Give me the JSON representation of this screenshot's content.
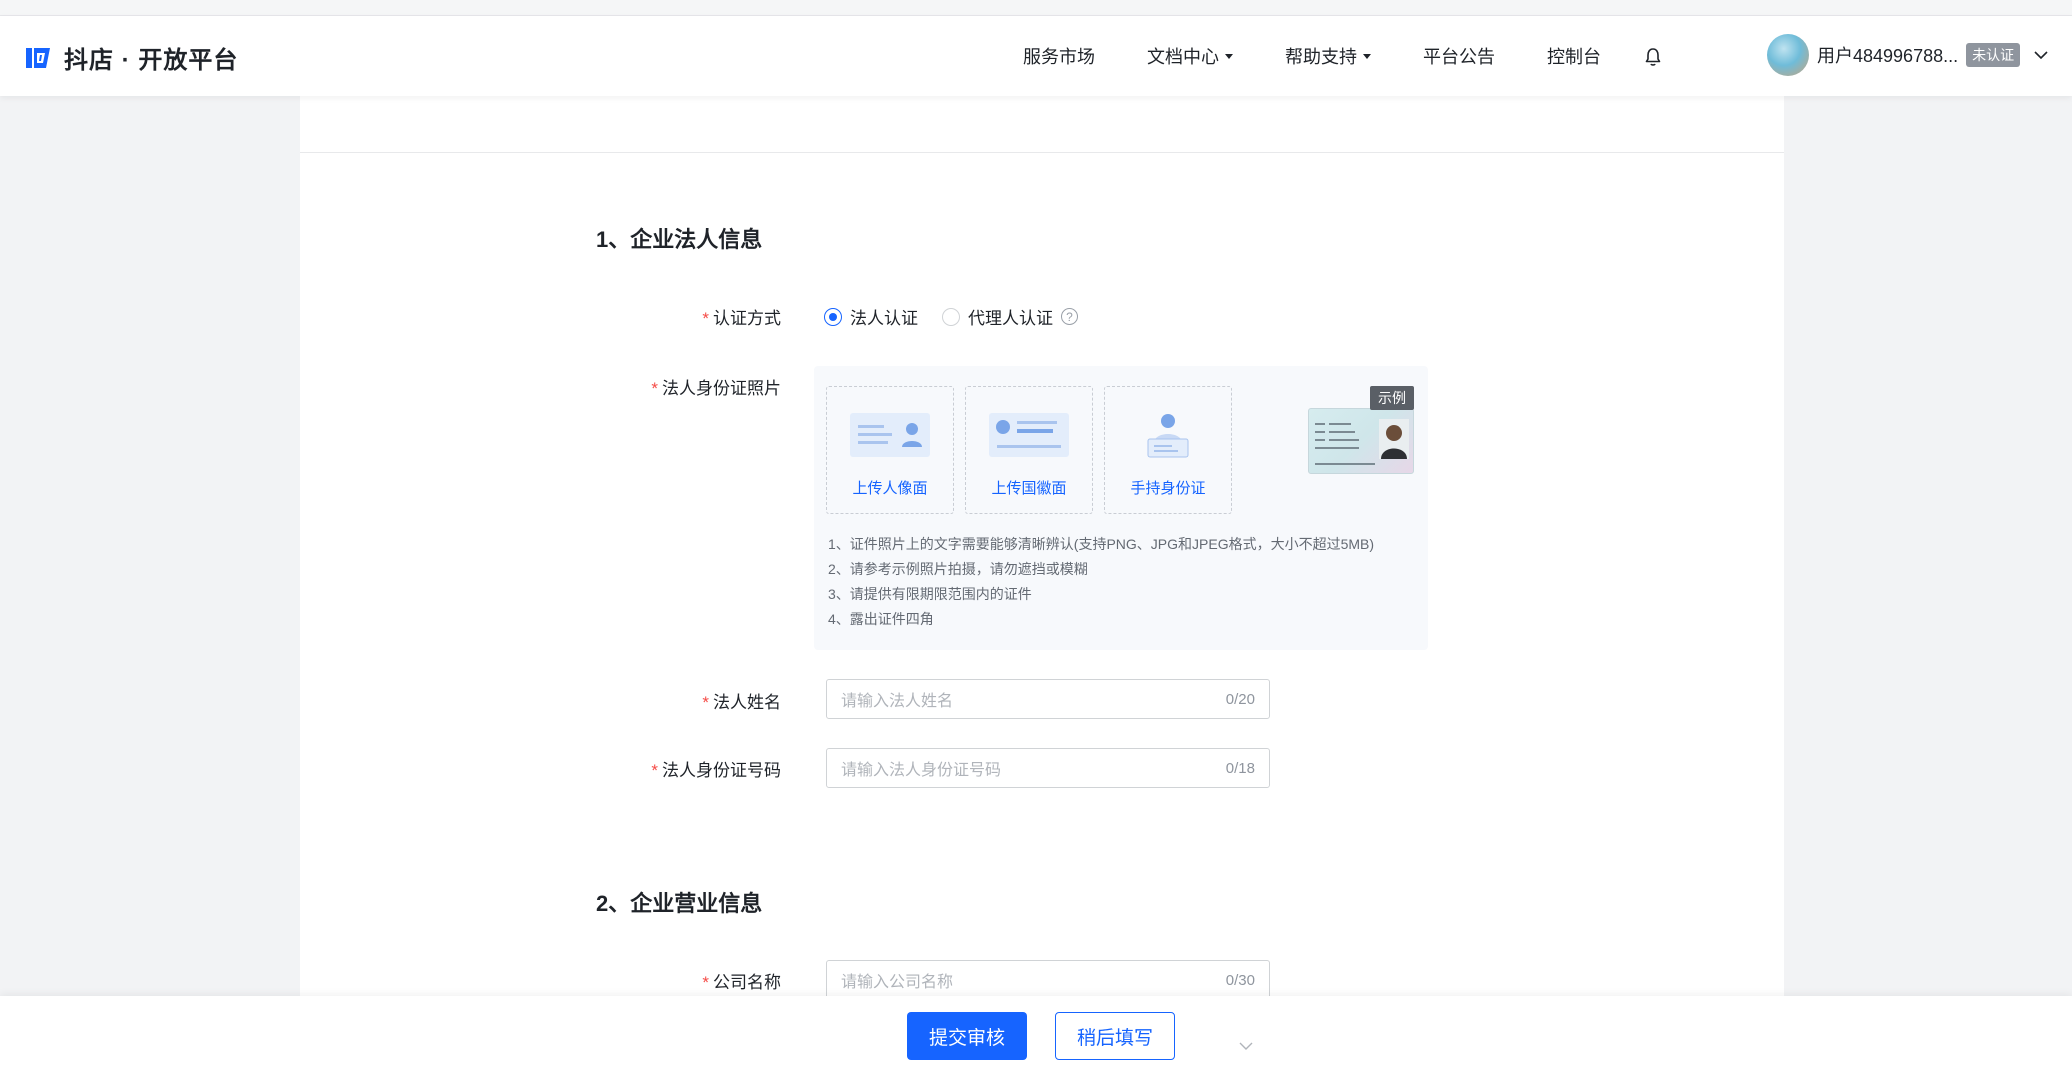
{
  "brand": {
    "name": "抖店 · 开放平台"
  },
  "nav": {
    "items": [
      {
        "label": "服务市场",
        "dropdown": false
      },
      {
        "label": "文档中心",
        "dropdown": true
      },
      {
        "label": "帮助支持",
        "dropdown": true
      },
      {
        "label": "平台公告",
        "dropdown": false
      },
      {
        "label": "控制台",
        "dropdown": false
      }
    ]
  },
  "user": {
    "name": "用户484996788...",
    "badge": "未认证"
  },
  "colors": {
    "accent": "#1664ff",
    "required": "#f54a45",
    "badge_bg": "#8f959e"
  },
  "section1": {
    "title": "1、企业法人信息",
    "auth_method": {
      "label": "认证方式",
      "options": [
        "法人认证",
        "代理人认证"
      ],
      "selected": "法人认证"
    },
    "id_photo": {
      "label": "法人身份证照片",
      "uploads": [
        "上传人像面",
        "上传国徽面",
        "手持身份证"
      ],
      "example_tag": "示例",
      "tips": [
        "1、证件照片上的文字需要能够清晰辨认(支持PNG、JPG和JPEG格式，大小不超过5MB)",
        "2、请参考示例照片拍摄，请勿遮挡或模糊",
        "3、请提供有限期限范围内的证件",
        "4、露出证件四角"
      ]
    },
    "legal_name": {
      "label": "法人姓名",
      "placeholder": "请输入法人姓名",
      "counter": "0/20"
    },
    "legal_id": {
      "label": "法人身份证号码",
      "placeholder": "请输入法人身份证号码",
      "counter": "0/18"
    }
  },
  "section2": {
    "title": "2、企业营业信息",
    "company_name": {
      "label": "公司名称",
      "placeholder": "请输入公司名称",
      "counter": "0/30"
    }
  },
  "footer": {
    "submit": "提交审核",
    "later": "稍后填写"
  }
}
